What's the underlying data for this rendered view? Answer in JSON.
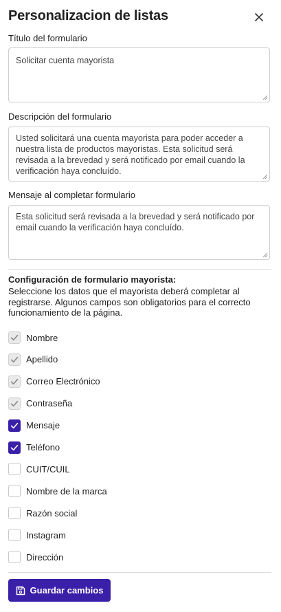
{
  "header": {
    "title": "Personalizacion de listas",
    "close_icon": "close-icon"
  },
  "fields": {
    "titulo": {
      "label": "Título del formulario",
      "value": "Solicitar cuenta mayorista"
    },
    "descripcion": {
      "label": "Descripción del formulario",
      "value": "Usted solicitará una cuenta mayorista para poder acceder a nuestra lista de productos mayoristas. Esta solicitud será revisada a la brevedad y será notificado por email cuando la verificación haya concluído."
    },
    "mensaje": {
      "label": "Mensaje al completar formulario",
      "value": "Esta solicitud será revisada a la brevedad y será notificado por email cuando la verificación haya concluído."
    }
  },
  "config": {
    "title": "Configuración de formulario mayorista:",
    "description": "Seleccione los datos que el mayorista deberá completar al registrarse. Algunos campos son obligatorios para el correcto funcionamiento de la página.",
    "options": [
      {
        "label": "Nombre",
        "state": "required"
      },
      {
        "label": "Apellido",
        "state": "required"
      },
      {
        "label": "Correo Electrónico",
        "state": "required"
      },
      {
        "label": "Contraseña",
        "state": "required"
      },
      {
        "label": "Mensaje",
        "state": "checked"
      },
      {
        "label": "Teléfono",
        "state": "checked"
      },
      {
        "label": "CUIT/CUIL",
        "state": "unchecked"
      },
      {
        "label": "Nombre de la marca",
        "state": "unchecked"
      },
      {
        "label": "Razón social",
        "state": "unchecked"
      },
      {
        "label": "Instagram",
        "state": "unchecked"
      },
      {
        "label": "Dirección",
        "state": "unchecked"
      }
    ]
  },
  "actions": {
    "save_label": "Guardar cambios",
    "save_icon": "save-icon"
  },
  "colors": {
    "accent": "#3a1fa8",
    "disabled_box": "#e9e9e9",
    "border": "#cfcfcf"
  }
}
